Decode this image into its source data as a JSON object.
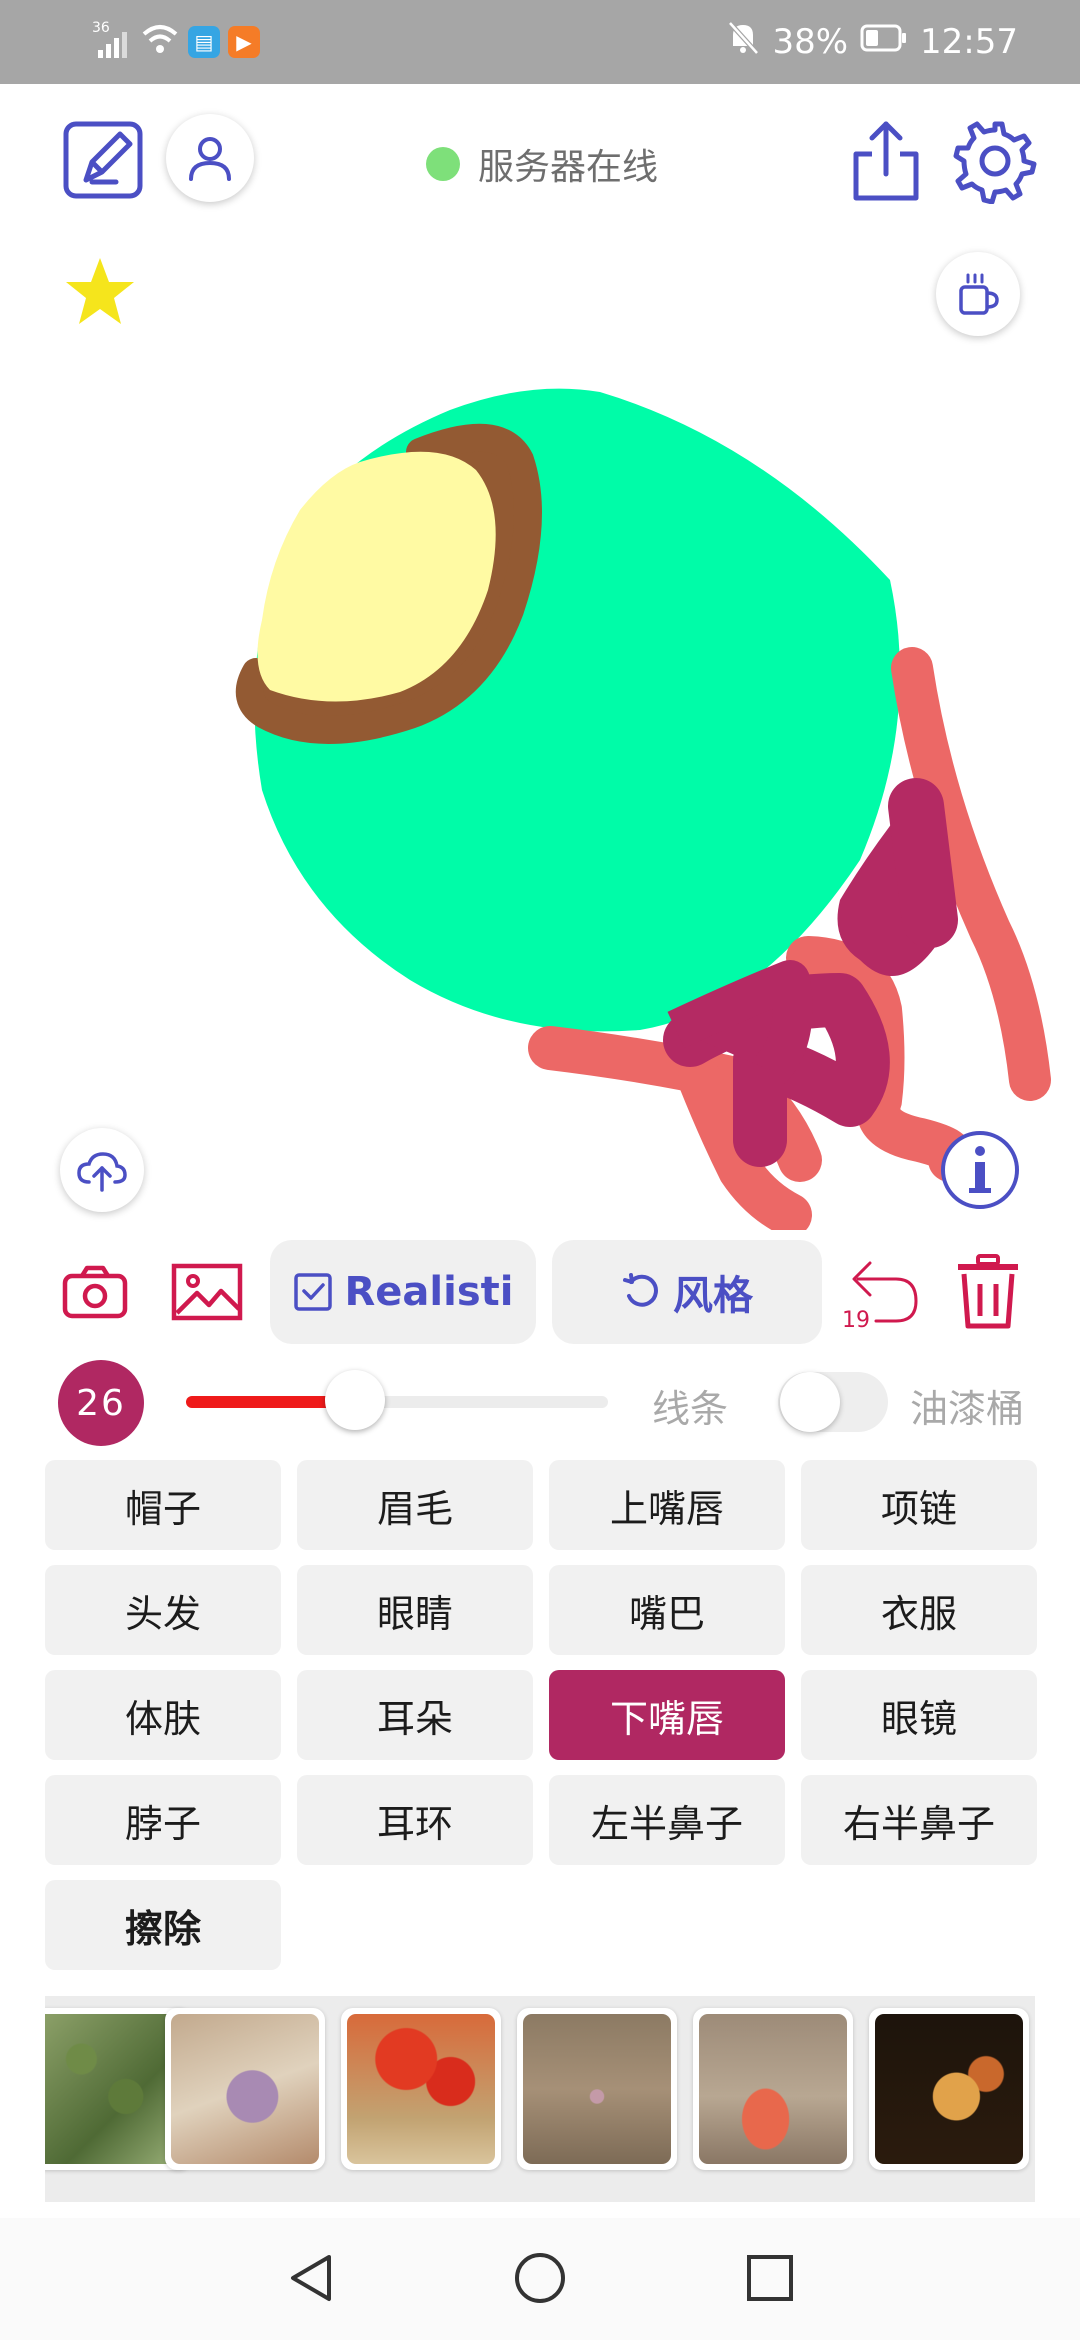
{
  "status_bar": {
    "network": "36",
    "battery_percent": "38%",
    "time": "12:57",
    "icons": [
      "signal-icon",
      "wifi-icon",
      "book-app-icon",
      "play-app-icon",
      "mute-bell-icon",
      "battery-icon"
    ]
  },
  "top_bar": {
    "server_status": "服务器在线",
    "server_status_color": "#7ee07a",
    "icons": [
      "edit-icon",
      "user-icon",
      "share-icon",
      "settings-icon",
      "star-icon",
      "coffee-icon"
    ]
  },
  "canvas": {
    "icons": [
      "cloud-upload-icon",
      "info-icon"
    ],
    "colors": {
      "skin": "#00fca8",
      "hair": "#fffaa3",
      "hat": "#935a33",
      "lips": "#b42a63",
      "clothes": "#ec6866"
    }
  },
  "toolbar": {
    "realistic_label": "Realisti",
    "style_label": "风格",
    "undo_count": "19",
    "accent": "#4b4fc4",
    "icon_color": "#d0194e"
  },
  "brush": {
    "size": "26",
    "slider_value": 0.4,
    "line_label": "线条",
    "bucket_label": "油漆桶",
    "bucket_enabled": false
  },
  "labels": [
    "帽子",
    "眉毛",
    "上嘴唇",
    "项链",
    "头发",
    "眼睛",
    "嘴巴",
    "衣服",
    "体肤",
    "耳朵",
    "下嘴唇",
    "眼镜",
    "脖子",
    "耳环",
    "左半鼻子",
    "右半鼻子",
    "擦除"
  ],
  "active_label": "下嘴唇",
  "thumbnails": [
    "style-thumb-1",
    "style-thumb-2",
    "style-thumb-3",
    "style-thumb-4",
    "style-thumb-5",
    "style-thumb-6"
  ],
  "nav": [
    "back-icon",
    "home-icon",
    "recents-icon"
  ]
}
